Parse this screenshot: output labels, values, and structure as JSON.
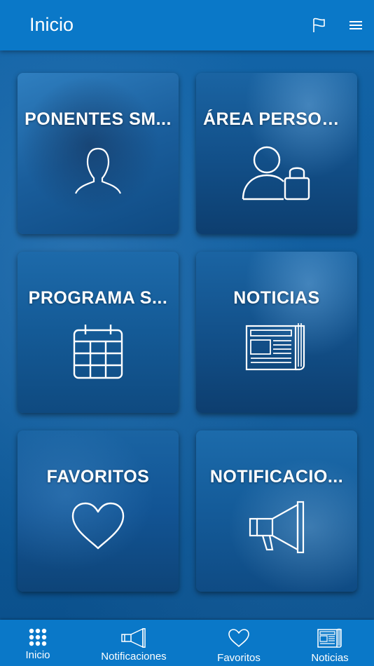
{
  "header": {
    "title": "Inicio",
    "flag_icon": "flag-icon",
    "menu_icon": "hamburger-menu-icon"
  },
  "tiles": [
    {
      "label": "PONENTES SM...",
      "icon": "person-icon"
    },
    {
      "label": "ÁREA PERSON...",
      "icon": "user-lock-icon"
    },
    {
      "label": "PROGRAMA S...",
      "icon": "calendar-icon"
    },
    {
      "label": "NOTICIAS",
      "icon": "newspaper-icon"
    },
    {
      "label": "FAVORITOS",
      "icon": "heart-icon"
    },
    {
      "label": "NOTIFICACIO...",
      "icon": "megaphone-icon"
    }
  ],
  "tabbar": {
    "items": [
      {
        "label": "Inicio",
        "icon": "grid-dots-icon"
      },
      {
        "label": "Notificaciones",
        "icon": "megaphone-icon"
      },
      {
        "label": "Favoritos",
        "icon": "heart-icon"
      },
      {
        "label": "Noticias",
        "icon": "newspaper-icon"
      }
    ]
  },
  "colors": {
    "header": "#0a78c8",
    "tabbar": "#0a78c8",
    "background": "#0e5c9e",
    "text": "#ffffff"
  }
}
